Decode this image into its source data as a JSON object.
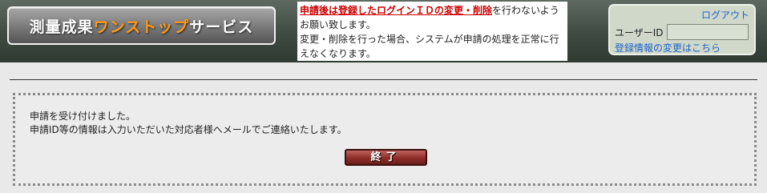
{
  "header": {
    "logo": {
      "part1": "測量成果",
      "part2": "ワンストップ",
      "part3": "サービス",
      "accent_color": "#ff9a1a"
    },
    "notice": {
      "warning": "申請後は登録したログインＩＤの変更・削除",
      "line1_rest": "を行わないようお願い致します。",
      "line2": "変更・削除を行った場合、システムが申請の処理を正常に行えなくなります。"
    },
    "user": {
      "logout_label": "ログアウト",
      "id_label": "ユーザーID",
      "id_value": "",
      "change_link": "登録情報の変更はこちら"
    }
  },
  "main": {
    "message1": "申請を受け付けました。",
    "message2": "申請ID等の情報は入力いただいた対応者様へメールでご連絡いたします。",
    "finish_label": "終了"
  }
}
